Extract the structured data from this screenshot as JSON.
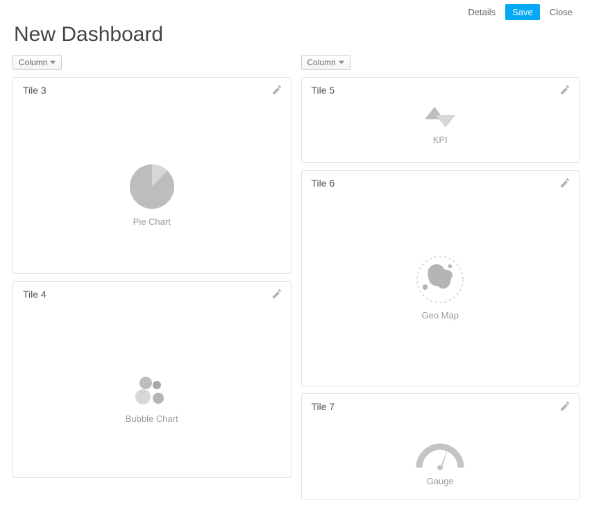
{
  "toolbar": {
    "details_label": "Details",
    "save_label": "Save",
    "close_label": "Close"
  },
  "page": {
    "title": "New Dashboard"
  },
  "columns": {
    "left": {
      "button_label": "Column",
      "tiles": [
        {
          "title": "Tile 3",
          "chart_label": "Pie Chart"
        },
        {
          "title": "Tile 4",
          "chart_label": "Bubble Chart"
        }
      ]
    },
    "right": {
      "button_label": "Column",
      "tiles": [
        {
          "title": "Tile 5",
          "chart_label": "KPI"
        },
        {
          "title": "Tile 6",
          "chart_label": "Geo Map"
        },
        {
          "title": "Tile 7",
          "chart_label": "Gauge"
        }
      ]
    }
  }
}
